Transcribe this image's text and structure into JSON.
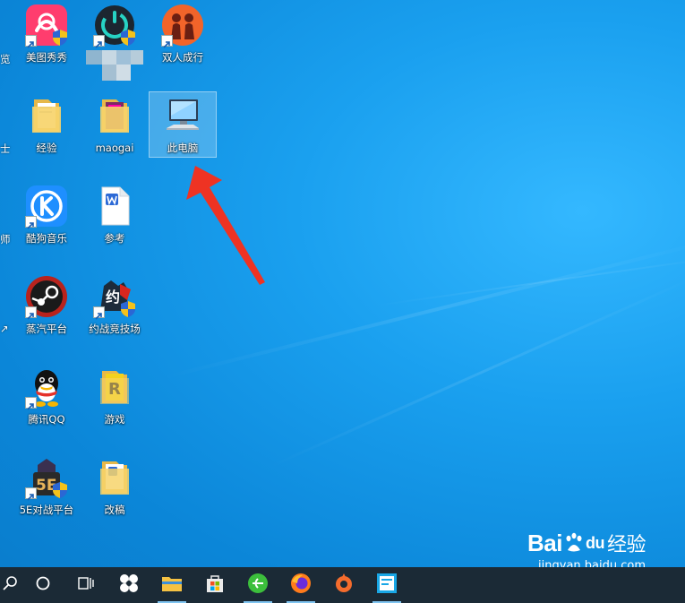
{
  "desktop": {
    "edge_labels": [
      "览",
      "士",
      "师",
      "↗"
    ],
    "icons": [
      {
        "name": "meitu-xiuxiu-icon",
        "label": "美图秀秀",
        "type": "meitu"
      },
      {
        "name": "app-blurred-icon",
        "label": "",
        "type": "power"
      },
      {
        "name": "it-takes-two-icon",
        "label": "双人成行",
        "type": "twopeople"
      },
      {
        "name": "folder-jingyan-icon",
        "label": "经验",
        "type": "folder"
      },
      {
        "name": "folder-maogai-icon",
        "label": "maogai",
        "type": "folder"
      },
      {
        "name": "this-pc-icon",
        "label": "此电脑",
        "type": "computer"
      },
      {
        "name": "kugou-music-icon",
        "label": "酷狗音乐",
        "type": "kugou"
      },
      {
        "name": "doc-cankao-icon",
        "label": "参考",
        "type": "word"
      },
      {
        "name": "steam-icon",
        "label": "蒸汽平台",
        "type": "steam"
      },
      {
        "name": "yuezhan-arena-icon",
        "label": "约战竞技场",
        "type": "yuezhan"
      },
      {
        "name": "tencent-qq-icon",
        "label": "腾讯QQ",
        "type": "qq"
      },
      {
        "name": "folder-games-icon",
        "label": "游戏",
        "type": "folderR"
      },
      {
        "name": "5e-platform-icon",
        "label": "5E对战平台",
        "type": "5e"
      },
      {
        "name": "folder-gaigao-icon",
        "label": "改稿",
        "type": "folderW"
      }
    ]
  },
  "taskbar": {
    "items": [
      {
        "name": "search-icon"
      },
      {
        "name": "cortana-icon"
      },
      {
        "name": "task-view-icon"
      },
      {
        "name": "pinwheel-app-icon"
      },
      {
        "name": "file-explorer-icon"
      },
      {
        "name": "microsoft-store-icon"
      },
      {
        "name": "browser-green-icon"
      },
      {
        "name": "firefox-icon"
      },
      {
        "name": "origin-icon"
      },
      {
        "name": "news-app-icon"
      }
    ]
  },
  "watermark": {
    "brand_left": "Bai",
    "brand_mid": "du",
    "brand_right": "经验",
    "url": "jingyan.baidu.com"
  },
  "colors": {
    "desktop_blue": "#0b86d8",
    "taskbar": "#1b2a36",
    "arrow": "#ee3323"
  }
}
